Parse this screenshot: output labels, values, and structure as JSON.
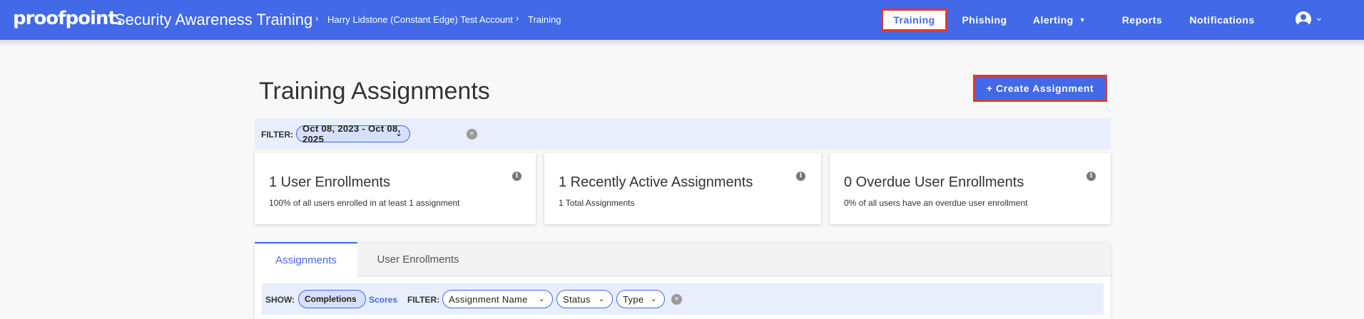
{
  "header": {
    "logo": "proofpoint.",
    "app_title": "Security Awareness Training",
    "breadcrumb": [
      "Harry Lidstone (Constant Edge) Test Account",
      "Training"
    ],
    "nav": [
      "Training",
      "Phishing",
      "Alerting",
      "Reports",
      "Notifications"
    ],
    "active_nav": "Training"
  },
  "page": {
    "title": "Training Assignments",
    "create_button": "+ Create Assignment"
  },
  "filter": {
    "label": "FILTER:",
    "date_range": "Oct 08, 2023 - Oct 08, 2025"
  },
  "cards": [
    {
      "title": "1 User Enrollments",
      "subtitle": "100% of all users enrolled in at least 1 assignment"
    },
    {
      "title": "1 Recently Active Assignments",
      "subtitle": "1 Total Assignments"
    },
    {
      "title": "0 Overdue User Enrollments",
      "subtitle": "0% of all users have an overdue user enrollment"
    }
  ],
  "tabs": [
    "Assignments",
    "User Enrollments"
  ],
  "active_tab": "Assignments",
  "toolbar": {
    "show_label": "SHOW:",
    "show_options": [
      "Completions",
      "Scores"
    ],
    "show_selected": "Completions",
    "filter_label": "FILTER:",
    "filters": [
      "Assignment Name",
      "Status",
      "Type"
    ]
  },
  "colors": {
    "brand": "#4169e8",
    "highlight_border": "#e03a2f",
    "filter_bg": "#e8eefb"
  }
}
